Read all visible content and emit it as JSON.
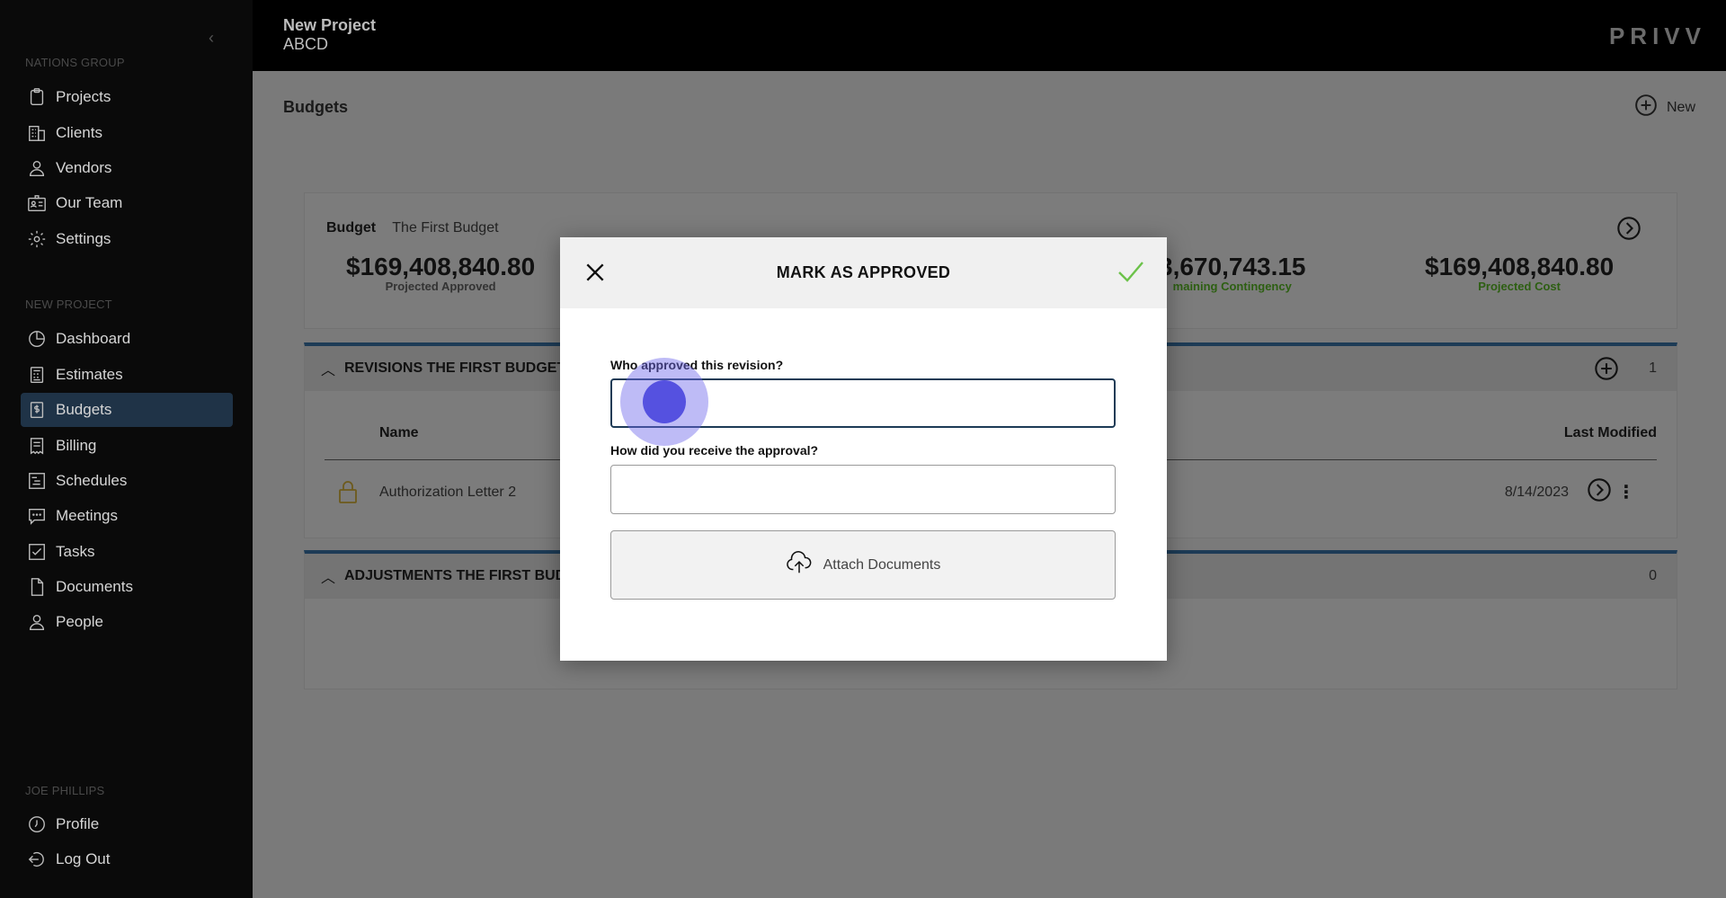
{
  "sidebar": {
    "org_label": "NATIONS GROUP",
    "org_items": [
      {
        "label": "Projects",
        "icon": "clipboard-icon"
      },
      {
        "label": "Clients",
        "icon": "building-icon"
      },
      {
        "label": "Vendors",
        "icon": "person-icon"
      },
      {
        "label": "Our Team",
        "icon": "id-card-icon"
      },
      {
        "label": "Settings",
        "icon": "gear-icon"
      }
    ],
    "project_label": "NEW PROJECT",
    "project_items": [
      {
        "label": "Dashboard",
        "icon": "pie-chart-icon"
      },
      {
        "label": "Estimates",
        "icon": "calculator-icon"
      },
      {
        "label": "Budgets",
        "icon": "dollar-document-icon",
        "active": true
      },
      {
        "label": "Billing",
        "icon": "invoice-icon"
      },
      {
        "label": "Schedules",
        "icon": "gantt-icon"
      },
      {
        "label": "Meetings",
        "icon": "chat-icon"
      },
      {
        "label": "Tasks",
        "icon": "checkbox-icon"
      },
      {
        "label": "Documents",
        "icon": "document-icon"
      },
      {
        "label": "People",
        "icon": "person-icon"
      }
    ],
    "user_label": "JOE PHILLIPS",
    "user_items": [
      {
        "label": "Profile",
        "icon": "profile-clock-icon"
      },
      {
        "label": "Log Out",
        "icon": "logout-icon"
      }
    ]
  },
  "header": {
    "project_title": "New Project",
    "project_sub": "ABCD",
    "brand": "PRIVV"
  },
  "page": {
    "title": "Budgets",
    "new_label": "New"
  },
  "budget": {
    "label": "Budget",
    "name": "The First Budget",
    "stats": [
      {
        "value": "$169,408,840.80",
        "label": "Projected Approved"
      },
      {
        "value": "3,670,743.15",
        "label": "maining Contingency"
      },
      {
        "value": "$169,408,840.80",
        "label": "Projected Cost"
      }
    ]
  },
  "revisions": {
    "title": "REVISIONS THE FIRST BUDGET",
    "count": "1",
    "col_name": "Name",
    "col_modified": "Last Modified",
    "rows": [
      {
        "name": "Authorization Letter 2",
        "date": "8/14/2023"
      }
    ]
  },
  "adjustments": {
    "title": "ADJUSTMENTS THE FIRST BUD",
    "count": "0"
  },
  "modal": {
    "title": "MARK AS APPROVED",
    "q1_label": "Who approved this revision?",
    "q1_value": "",
    "q2_label": "How did you receive the approval?",
    "q2_value": "",
    "attach_label": "Attach Documents"
  },
  "colors": {
    "active_nav": "#1f3347",
    "section_accent": "#1d3b56",
    "confirm_check": "#6cc24a",
    "click_indicator": "#5551e0"
  }
}
